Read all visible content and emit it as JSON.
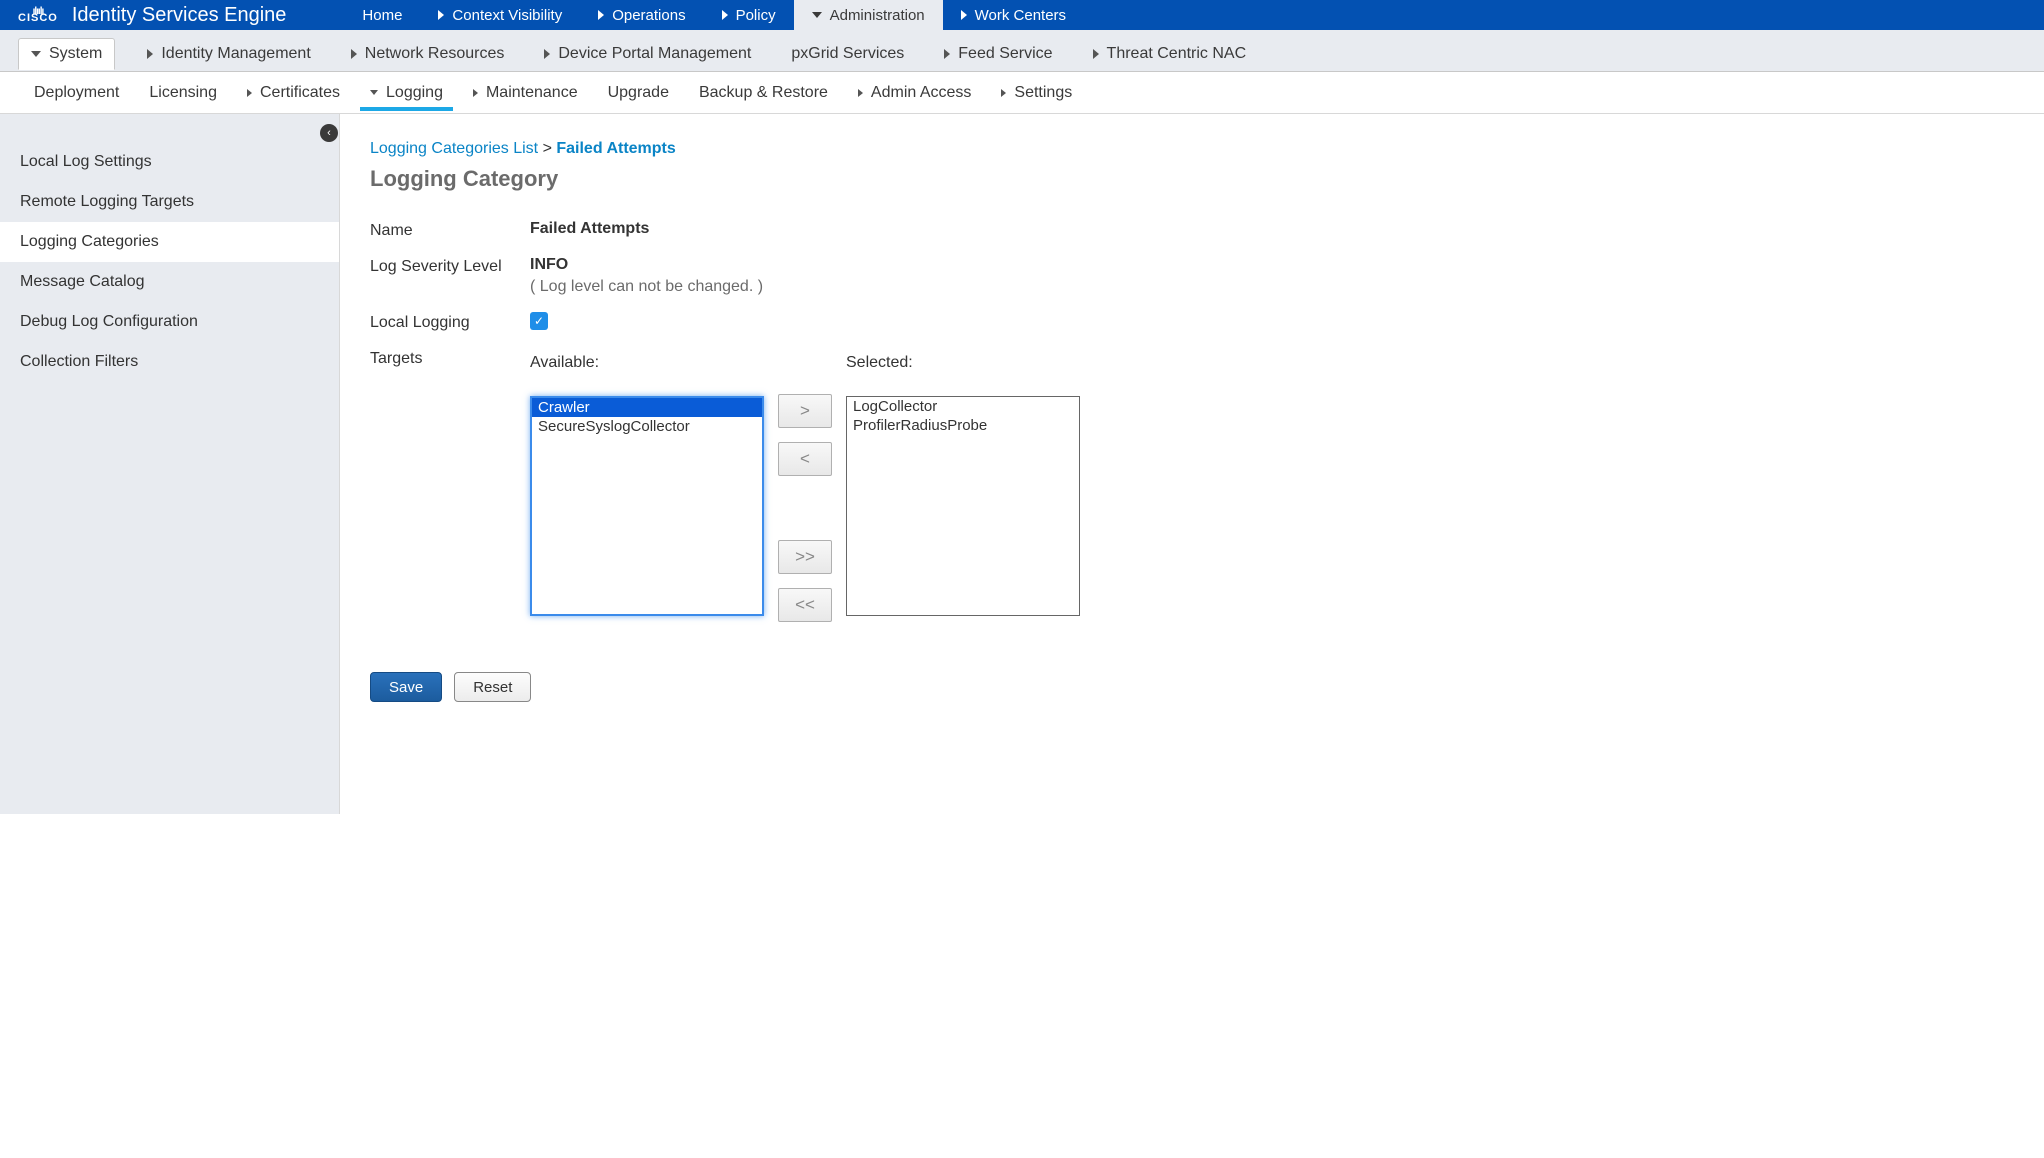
{
  "brand": {
    "logo_text": "CISCO",
    "app_title": "Identity Services Engine"
  },
  "topnav": [
    {
      "label": "Home",
      "arrow": "none"
    },
    {
      "label": "Context Visibility",
      "arrow": "right"
    },
    {
      "label": "Operations",
      "arrow": "right"
    },
    {
      "label": "Policy",
      "arrow": "right"
    },
    {
      "label": "Administration",
      "arrow": "down",
      "active": true
    },
    {
      "label": "Work Centers",
      "arrow": "right"
    }
  ],
  "subnav": [
    {
      "label": "System",
      "arrow": "down",
      "active": true
    },
    {
      "label": "Identity Management",
      "arrow": "right"
    },
    {
      "label": "Network Resources",
      "arrow": "right"
    },
    {
      "label": "Device Portal Management",
      "arrow": "right"
    },
    {
      "label": "pxGrid Services",
      "arrow": "none"
    },
    {
      "label": "Feed Service",
      "arrow": "right"
    },
    {
      "label": "Threat Centric NAC",
      "arrow": "right"
    }
  ],
  "tertnav": [
    {
      "label": "Deployment",
      "arrow": "none"
    },
    {
      "label": "Licensing",
      "arrow": "none"
    },
    {
      "label": "Certificates",
      "arrow": "right"
    },
    {
      "label": "Logging",
      "arrow": "down",
      "active": true
    },
    {
      "label": "Maintenance",
      "arrow": "right"
    },
    {
      "label": "Upgrade",
      "arrow": "none"
    },
    {
      "label": "Backup & Restore",
      "arrow": "none"
    },
    {
      "label": "Admin Access",
      "arrow": "right"
    },
    {
      "label": "Settings",
      "arrow": "right"
    }
  ],
  "sidebar": [
    {
      "label": "Local Log Settings"
    },
    {
      "label": "Remote Logging Targets"
    },
    {
      "label": "Logging Categories",
      "active": true
    },
    {
      "label": "Message Catalog"
    },
    {
      "label": "Debug Log Configuration"
    },
    {
      "label": "Collection Filters"
    }
  ],
  "breadcrumb": {
    "parent": "Logging Categories List",
    "sep": ">",
    "current": "Failed Attempts"
  },
  "page_title": "Logging Category",
  "form": {
    "name_label": "Name",
    "name_value": "Failed Attempts",
    "sev_label": "Log Severity Level",
    "sev_value": "INFO",
    "sev_note": "( Log level can not be changed. )",
    "local_label": "Local Logging",
    "local_checked": true,
    "targets_label": "Targets",
    "available_label": "Available:",
    "selected_label": "Selected:",
    "available_items": [
      {
        "label": "Crawler",
        "selected": true
      },
      {
        "label": "SecureSyslogCollector"
      }
    ],
    "selected_items": [
      {
        "label": "LogCollector"
      },
      {
        "label": "ProfilerRadiusProbe"
      }
    ],
    "move_right": ">",
    "move_left": "<",
    "move_all_right": ">>",
    "move_all_left": "<<"
  },
  "actions": {
    "save": "Save",
    "reset": "Reset"
  }
}
